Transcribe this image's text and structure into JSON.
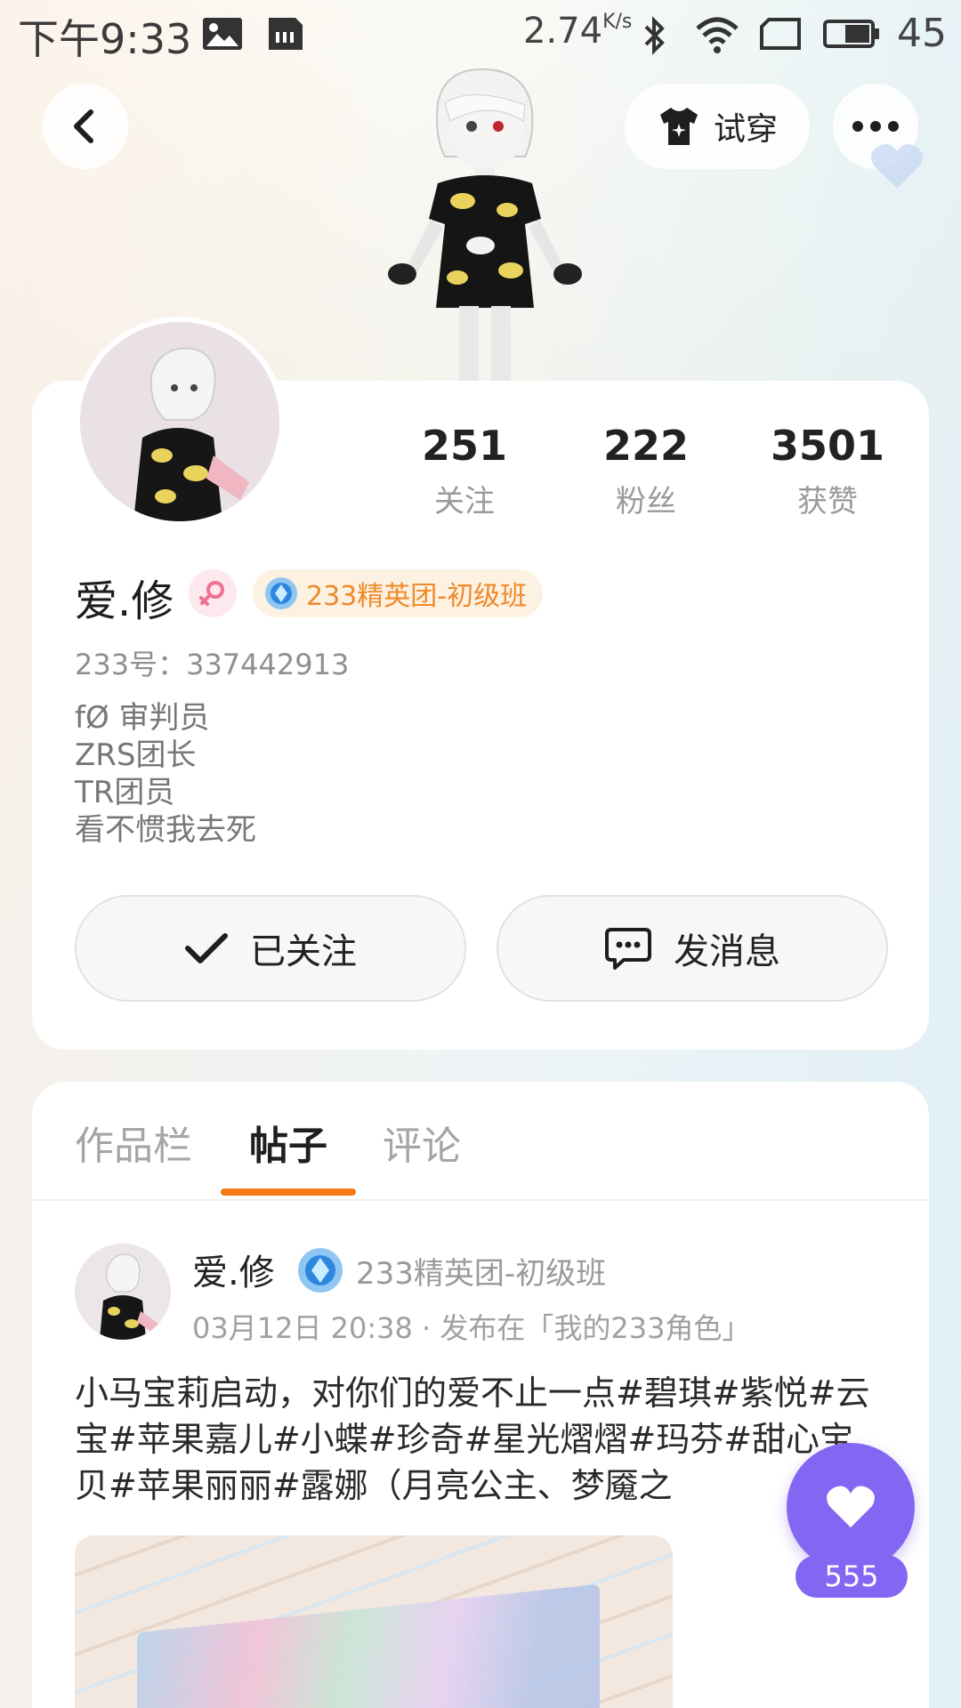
{
  "status_bar": {
    "time": "下午9:33",
    "net_speed": "2.74",
    "net_speed_unit": "K/s",
    "battery": "45",
    "icons": [
      "image-icon",
      "sim-icon",
      "bluetooth-icon",
      "wifi-icon",
      "screen-icon",
      "battery-icon"
    ]
  },
  "header": {
    "back_icon": "chevron-left-icon",
    "try_on_label": "试穿",
    "more_icon": "more-dots-icon"
  },
  "profile": {
    "stats": [
      {
        "value": "251",
        "label": "关注"
      },
      {
        "value": "222",
        "label": "粉丝"
      },
      {
        "value": "3501",
        "label": "获赞"
      }
    ],
    "name": "爱.修",
    "gender": "female",
    "club_badge": "233精英团-初级班",
    "account_id": "233号：337442913",
    "bio": [
      "fØ 审判员",
      "ZRS团长",
      "TR团员",
      "看不惯我去死"
    ],
    "follow_label": "已关注",
    "message_label": "发消息"
  },
  "tabs": {
    "items": [
      "作品栏",
      "帖子",
      "评论"
    ],
    "active": "帖子"
  },
  "post": {
    "author": "爱.修",
    "club": "233精英团-初级班",
    "meta": "03月12日 20:38 · 发布在「我的233角色」",
    "text": "小马宝莉启动，对你们的爱不止一点#碧琪#紫悦#云宝#苹果嘉儿#小蝶#珍奇#星光熠熠#玛芬#甜心宝贝#苹果丽丽#露娜（月亮公主、梦魇之"
  },
  "like": {
    "count": "555"
  },
  "colors": {
    "accent_orange": "#f57a14",
    "like_purple": "#8367f3",
    "badge_orange": "#ef8a2b"
  }
}
